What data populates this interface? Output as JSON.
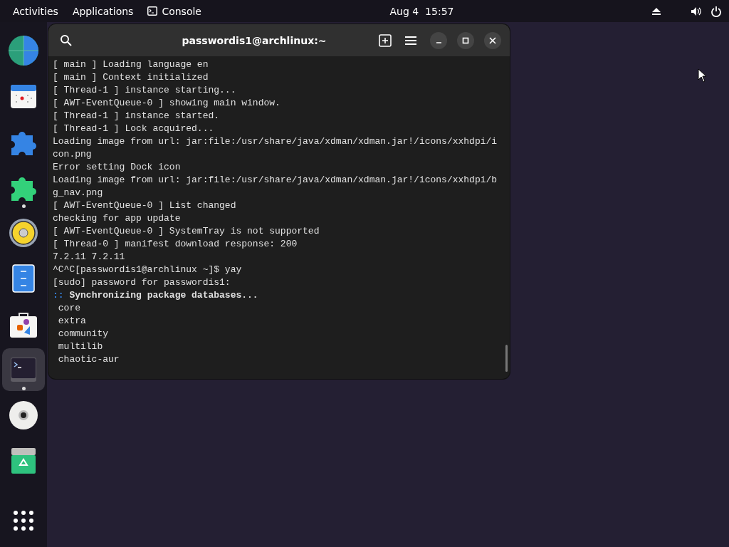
{
  "top_bar": {
    "activities": "Activities",
    "applications": "Applications",
    "app_name": "Console",
    "clock": "Aug 4  15:57"
  },
  "dock": {
    "apps": [
      {
        "kind": "globe",
        "running": false,
        "selected": false
      },
      {
        "kind": "calendar",
        "running": false,
        "selected": false
      },
      {
        "kind": "puzzle-blue",
        "running": false,
        "selected": false
      },
      {
        "kind": "puzzle-green",
        "running": true,
        "selected": false
      },
      {
        "kind": "speaker",
        "running": false,
        "selected": false
      },
      {
        "kind": "cabinet",
        "running": false,
        "selected": false
      },
      {
        "kind": "store",
        "running": false,
        "selected": false
      },
      {
        "kind": "terminal",
        "running": true,
        "selected": true
      },
      {
        "kind": "disc",
        "running": false,
        "selected": false
      },
      {
        "kind": "trash",
        "running": false,
        "selected": false
      }
    ]
  },
  "terminal": {
    "title": "passwordis1@archlinux:~",
    "lines": [
      {
        "kind": "plain",
        "text": "[ main ] Loading language en"
      },
      {
        "kind": "plain",
        "text": "[ main ] Context initialized"
      },
      {
        "kind": "plain",
        "text": "[ Thread-1 ] instance starting..."
      },
      {
        "kind": "plain",
        "text": "[ AWT-EventQueue-0 ] showing main window."
      },
      {
        "kind": "plain",
        "text": "[ Thread-1 ] instance started."
      },
      {
        "kind": "plain",
        "text": "[ Thread-1 ] Lock acquired..."
      },
      {
        "kind": "plain",
        "text": "Loading image from url: jar:file:/usr/share/java/xdman/xdman.jar!/icons/xxhdpi/i"
      },
      {
        "kind": "plain",
        "text": "con.png"
      },
      {
        "kind": "plain",
        "text": "Error setting Dock icon"
      },
      {
        "kind": "plain",
        "text": "Loading image from url: jar:file:/usr/share/java/xdman/xdman.jar!/icons/xxhdpi/b"
      },
      {
        "kind": "plain",
        "text": "g_nav.png"
      },
      {
        "kind": "plain",
        "text": "[ AWT-EventQueue-0 ] List changed"
      },
      {
        "kind": "plain",
        "text": "checking for app update"
      },
      {
        "kind": "plain",
        "text": "[ AWT-EventQueue-0 ] SystemTray is not supported"
      },
      {
        "kind": "plain",
        "text": "[ Thread-0 ] manifest download response: 200"
      },
      {
        "kind": "plain",
        "text": "7.2.11 7.2.11"
      },
      {
        "kind": "plain",
        "text": "^C^C[passwordis1@archlinux ~]$ yay"
      },
      {
        "kind": "plain",
        "text": "[sudo] password for passwordis1:"
      },
      {
        "kind": "heading",
        "prefix": "::",
        "text": "Synchronizing package databases..."
      },
      {
        "kind": "plain",
        "text": " core"
      },
      {
        "kind": "plain",
        "text": " extra"
      },
      {
        "kind": "plain",
        "text": " community"
      },
      {
        "kind": "plain",
        "text": " multilib"
      },
      {
        "kind": "plain",
        "text": " chaotic-aur"
      }
    ]
  }
}
